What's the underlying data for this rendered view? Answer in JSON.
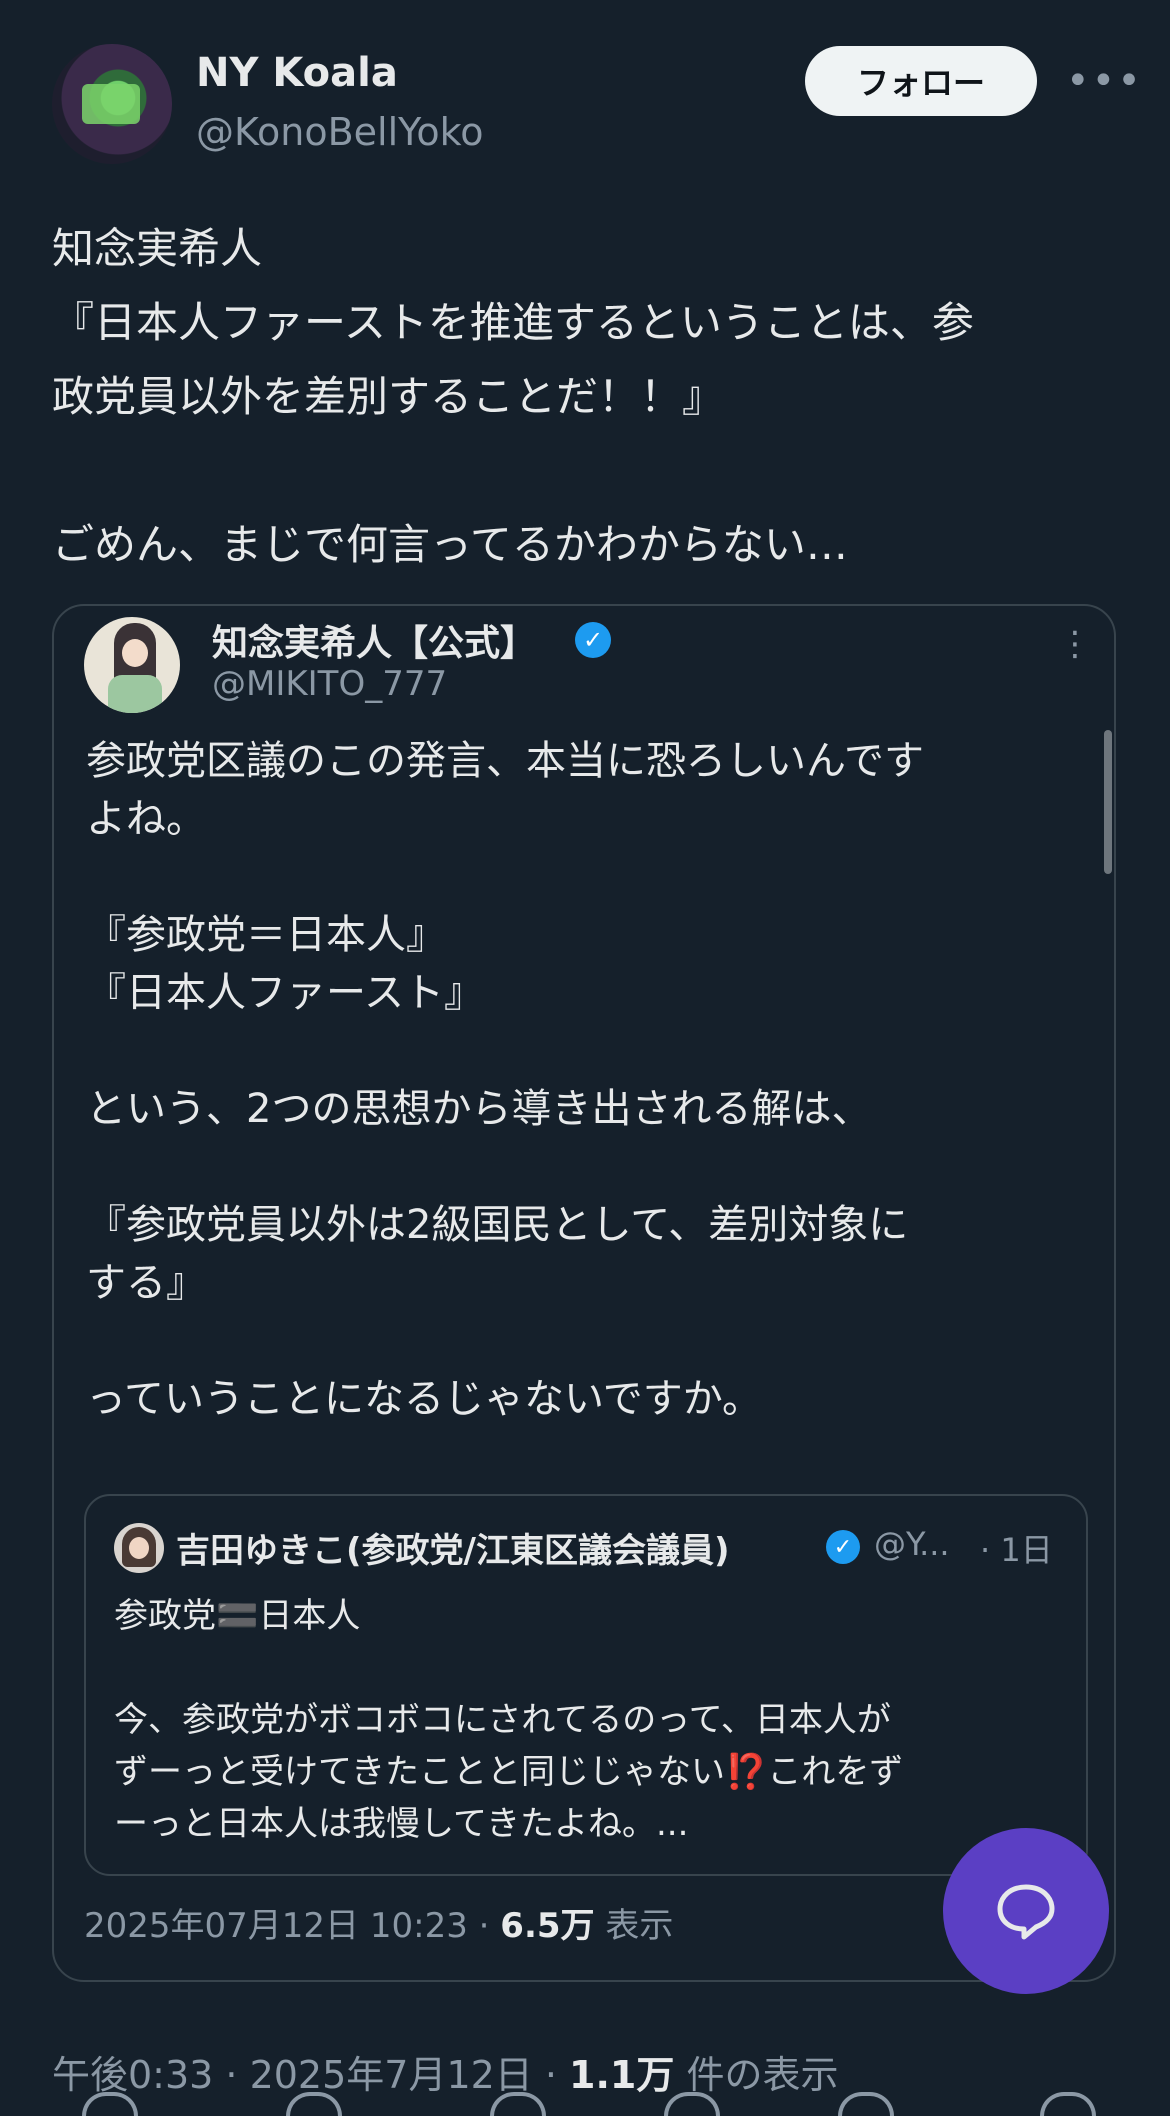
{
  "author": {
    "name": "NY Koala",
    "handle": "@KonoBellYoko",
    "follow_label": "フォロー",
    "more_label": "•••"
  },
  "tweet": {
    "text": "知念実希人\n『日本人ファーストを推進するということは、参\n政党員以外を差別することだ！！』\n\nごめん、まじで何言ってるかわからない…"
  },
  "quoted": {
    "name": "知念実希人【公式】",
    "handle": "@MIKITO_777",
    "more_label": "⋮",
    "text": "参政党区議のこの発言、本当に恐ろしいんです\nよね。\n\n『参政党＝日本人』\n『日本人ファースト』\n\nという、2つの思想から導き出される解は、\n\n『参政党員以外は2級国民として、差別対象に\nする』\n\nっていうことになるじゃないですか。",
    "date": "2025年07月12日 10:23 · ",
    "views": "6.5万",
    "views_label": " 表示"
  },
  "nested": {
    "name": "吉田ゆきこ(参政党/江東区議会議員)",
    "handle": "@Y...",
    "time": "· 1日",
    "text": "参政党🟰日本人\n\n今、参政党がボコボコにされてるのって、日本人が\nずーっと受けてきたことと同じじゃない⁉️これをず\nーっと日本人は我慢してきたよね。..."
  },
  "footer": {
    "time": "午後0:33 · 2025年7月12日 · ",
    "views": "1.1万",
    "views_label": " 件の表示"
  },
  "icons": {
    "verified": "verified-badge-icon",
    "fab": "chat-bubble-icon"
  },
  "colors": {
    "background": "#15202b",
    "text": "#e7e9ea",
    "muted": "#8b98a5",
    "border": "#38444d",
    "verified": "#1d9bf0",
    "fab": "#5b3fc4"
  }
}
